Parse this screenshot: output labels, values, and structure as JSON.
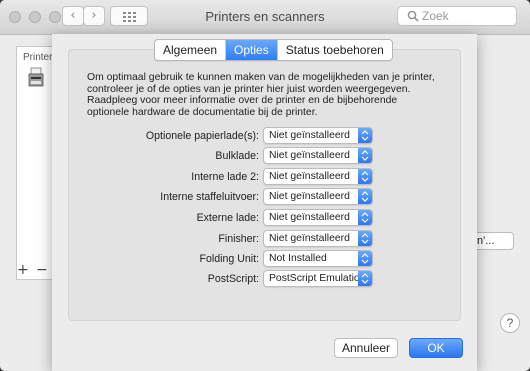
{
  "window": {
    "title": "Printers en scanners",
    "search_placeholder": "Zoek"
  },
  "background": {
    "list_header": "Printers",
    "partial_button_label": "n'...",
    "add_symbol": "+",
    "remove_symbol": "−",
    "help_symbol": "?"
  },
  "sheet": {
    "tabs": [
      {
        "label": "Algemeen",
        "active": false
      },
      {
        "label": "Opties",
        "active": true
      },
      {
        "label": "Status toebehoren",
        "active": false
      }
    ],
    "description": "Om optimaal gebruik te kunnen maken van de mogelijkheden van je printer, controleer je of de opties van je printer hier juist worden weergegeven. Raadpleeg voor meer informatie over de printer en de bijbehorende optionele hardware de documentatie bij de printer.",
    "options": [
      {
        "label": "Optionele papierlade(s):",
        "value": "Niet geïnstalleerd"
      },
      {
        "label": "Bulklade:",
        "value": "Niet geïnstalleerd"
      },
      {
        "label": "Interne lade 2:",
        "value": "Niet geïnstalleerd"
      },
      {
        "label": "Interne staffeluitvoer:",
        "value": "Niet geïnstalleerd"
      },
      {
        "label": "Externe lade:",
        "value": "Niet geïnstalleerd"
      },
      {
        "label": "Finisher:",
        "value": "Niet geïnstalleerd"
      },
      {
        "label": "Folding Unit:",
        "value": "Not Installed"
      },
      {
        "label": "PostScript:",
        "value": "PostScript Emulation"
      }
    ],
    "cancel_label": "Annuleer",
    "ok_label": "OK"
  },
  "colors": {
    "accent": "#2f7cf6",
    "window_bg": "#ececec"
  }
}
